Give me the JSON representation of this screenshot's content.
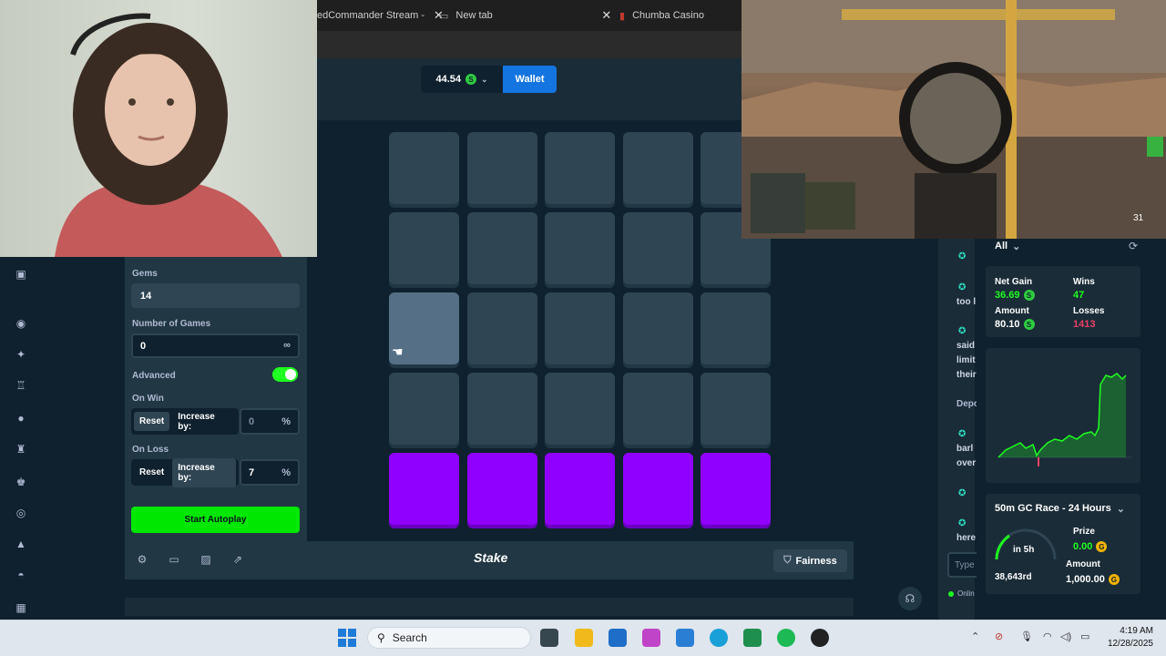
{
  "browser": {
    "tabs": [
      {
        "label": "edCommander Stream -"
      },
      {
        "label": "New tab"
      },
      {
        "label": "Chumba Casino"
      }
    ]
  },
  "header": {
    "balance": "44.54",
    "wallet_label": "Wallet"
  },
  "autoplay": {
    "gems_label": "Gems",
    "gems_value": "14",
    "games_label": "Number of Games",
    "games_value": "0",
    "infinity_symbol": "∞",
    "advanced_label": "Advanced",
    "advanced_on": true,
    "on_win_label": "On Win",
    "on_win": {
      "reset": "Reset",
      "increase": "Increase by:",
      "value": "0",
      "unit": "%"
    },
    "on_loss_label": "On Loss",
    "on_loss": {
      "reset": "Reset",
      "increase": "Increase by:",
      "value": "7",
      "unit": "%"
    },
    "start_label": "Start Autoplay"
  },
  "grid": {
    "rows": 5,
    "cols": 5,
    "hover_tile": [
      2,
      0
    ],
    "gem_row": 4
  },
  "footer": {
    "logo": "Stake",
    "fairness_label": "Fairness"
  },
  "chat": {
    "fragments": [
      "too l",
      "said",
      "limit",
      "their",
      "Depo",
      "barl",
      "over",
      "here"
    ],
    "type_placeholder": "Type",
    "online_label": "Onlin"
  },
  "stats": {
    "filter": "All",
    "net_gain_label": "Net Gain",
    "net_gain": "36.69",
    "wins_label": "Wins",
    "wins": "47",
    "amount_label": "Amount",
    "amount": "80.10",
    "losses_label": "Losses",
    "losses": "1413",
    "race_title": "50m GC Race - 24 Hours",
    "race_time": "in 5h",
    "race_rank": "38,643rd",
    "prize_label": "Prize",
    "prize": "0.00",
    "race_amount_label": "Amount",
    "race_amount": "1,000.00"
  },
  "colors": {
    "gem": "#9000ff",
    "accent_green": "#00e701",
    "wallet_blue": "#1475e1",
    "loss_red": "#ed4163"
  },
  "stream_hud": {
    "ammo": "31"
  },
  "taskbar": {
    "search_placeholder": "Search",
    "time": "4:19 AM",
    "date": "12/28/2025"
  }
}
